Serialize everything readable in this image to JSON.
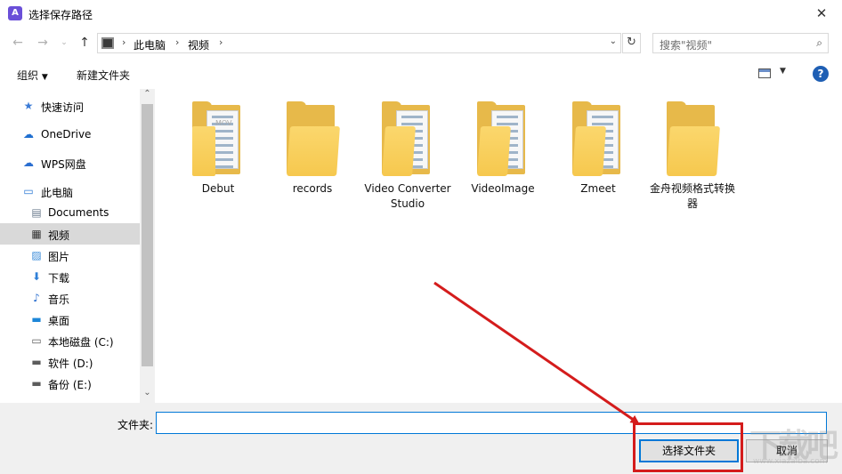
{
  "window": {
    "title": "选择保存路径",
    "app_icon": "app-logo-icon",
    "close_icon": "close-icon"
  },
  "navigation": {
    "back_icon": "back-arrow-icon",
    "forward_icon": "forward-arrow-icon",
    "recent_icon": "chevron-down-icon",
    "up_icon": "up-arrow-icon",
    "breadcrumbs": [
      "此电脑",
      "视频"
    ],
    "refresh_icon": "refresh-icon",
    "search_placeholder": "搜索\"视频\""
  },
  "toolbar": {
    "organize_label": "组织",
    "new_folder_label": "新建文件夹",
    "view_icon": "view-options-icon",
    "help_icon": "help-icon",
    "help_symbol": "?"
  },
  "sidebar": {
    "items": [
      {
        "label": "快速访问",
        "icon": "star-icon",
        "glyph": "★",
        "color": "#3b7bd6"
      },
      {
        "label": "OneDrive",
        "icon": "cloud-icon",
        "glyph": "☁",
        "color": "#1f6fd0"
      },
      {
        "label": "WPS网盘",
        "icon": "cloud-icon",
        "glyph": "☁",
        "color": "#2a6ed0"
      },
      {
        "label": "此电脑",
        "icon": "computer-icon",
        "glyph": "▭",
        "color": "#2b78d4"
      },
      {
        "label": "Documents",
        "icon": "document-icon",
        "glyph": "▤",
        "color": "#6d7d8f"
      },
      {
        "label": "视频",
        "icon": "video-icon",
        "glyph": "▦",
        "color": "#333333"
      },
      {
        "label": "图片",
        "icon": "picture-icon",
        "glyph": "▨",
        "color": "#3a8bd8"
      },
      {
        "label": "下载",
        "icon": "download-icon",
        "glyph": "⬇",
        "color": "#2f7fd8"
      },
      {
        "label": "音乐",
        "icon": "music-icon",
        "glyph": "♪",
        "color": "#2b6fcf"
      },
      {
        "label": "桌面",
        "icon": "desktop-icon",
        "glyph": "▬",
        "color": "#1c86d8"
      },
      {
        "label": "本地磁盘 (C:)",
        "icon": "drive-icon",
        "glyph": "▭",
        "color": "#5c5c5c"
      },
      {
        "label": "软件 (D:)",
        "icon": "drive-icon",
        "glyph": "▬",
        "color": "#5c5c5c"
      },
      {
        "label": "备份 (E:)",
        "icon": "drive-icon",
        "glyph": "▬",
        "color": "#5c5c5c"
      }
    ],
    "selected": "视频"
  },
  "folders": [
    {
      "name": "Debut",
      "variant": "mov"
    },
    {
      "name": "records",
      "variant": "plain"
    },
    {
      "name": "Video Converter Studio",
      "variant": "doc"
    },
    {
      "name": "VideoImage",
      "variant": "doc"
    },
    {
      "name": "Zmeet",
      "variant": "doc"
    },
    {
      "name": "金舟视频格式转换器",
      "variant": "plain"
    }
  ],
  "footer": {
    "folder_label": "文件夹:",
    "folder_value": "",
    "select_button": "选择文件夹",
    "cancel_button": "取消"
  },
  "annotation": {
    "arrow_color": "#d41c1c"
  },
  "watermark": {
    "text": "下载吧",
    "subtext": "www.xiazaiba.com"
  }
}
